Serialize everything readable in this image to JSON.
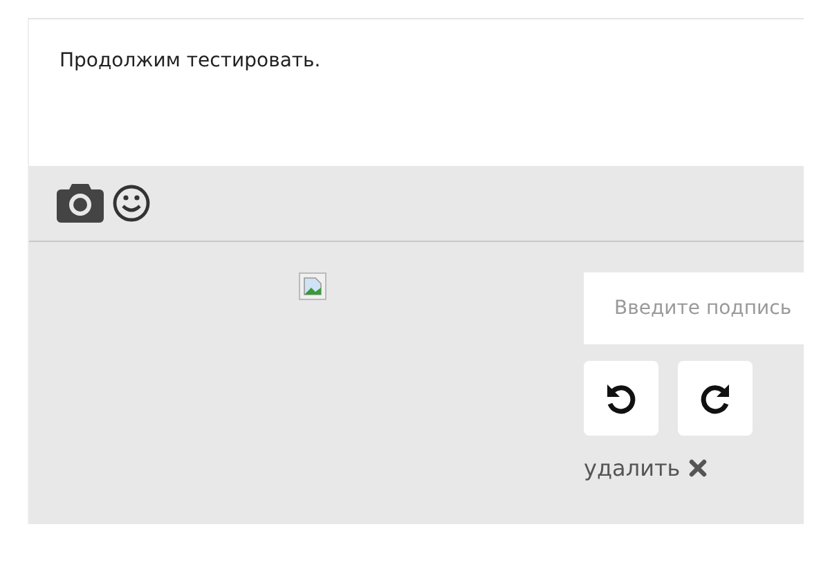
{
  "message": {
    "text": "Продолжим тестировать."
  },
  "toolbar": {
    "buttons": [
      {
        "kind": "camera"
      },
      {
        "kind": "emoji"
      }
    ]
  },
  "attachment": {
    "caption": {
      "placeholder": "Введите подпись"
    },
    "rotate_buttons": [
      {
        "kind": "left"
      },
      {
        "kind": "right"
      }
    ],
    "delete_link": "удалить"
  }
}
